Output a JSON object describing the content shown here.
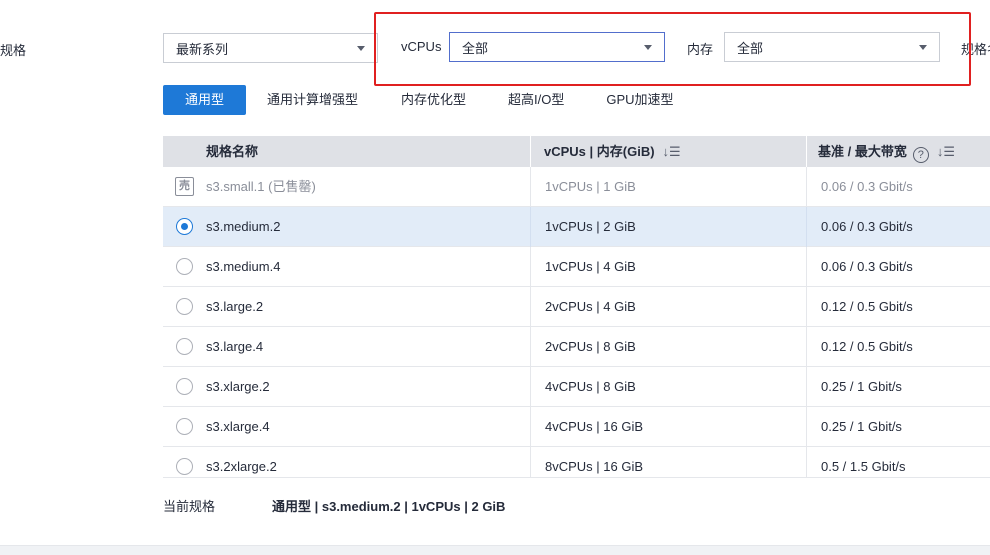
{
  "filters": {
    "section_label": "规格",
    "series": {
      "value": "最新系列"
    },
    "vcpus": {
      "label": "vCPUs",
      "value": "全部"
    },
    "memory": {
      "label": "内存",
      "value": "全部"
    },
    "spec_label_clipped": "规格名"
  },
  "tabs": [
    {
      "label": "通用型",
      "active": true
    },
    {
      "label": "通用计算增强型",
      "active": false
    },
    {
      "label": "内存优化型",
      "active": false
    },
    {
      "label": "超高I/O型",
      "active": false
    },
    {
      "label": "GPU加速型",
      "active": false
    }
  ],
  "table": {
    "headers": {
      "name": "规格名称",
      "cpu_mem": "vCPUs | 内存(GiB)",
      "bandwidth": "基准 / 最大带宽",
      "help": "?",
      "sort": "↓☰"
    },
    "soldout_icon_glyph": "売",
    "rows": [
      {
        "name": "s3.small.1 (已售罄)",
        "cpu_mem": "1vCPUs | 1 GiB",
        "bandwidth": "0.06 / 0.3 Gbit/s",
        "state": "soldout"
      },
      {
        "name": "s3.medium.2",
        "cpu_mem": "1vCPUs | 2 GiB",
        "bandwidth": "0.06 / 0.3 Gbit/s",
        "state": "selected"
      },
      {
        "name": "s3.medium.4",
        "cpu_mem": "1vCPUs | 4 GiB",
        "bandwidth": "0.06 / 0.3 Gbit/s",
        "state": "normal"
      },
      {
        "name": "s3.large.2",
        "cpu_mem": "2vCPUs | 4 GiB",
        "bandwidth": "0.12 / 0.5 Gbit/s",
        "state": "normal"
      },
      {
        "name": "s3.large.4",
        "cpu_mem": "2vCPUs | 8 GiB",
        "bandwidth": "0.12 / 0.5 Gbit/s",
        "state": "normal"
      },
      {
        "name": "s3.xlarge.2",
        "cpu_mem": "4vCPUs | 8 GiB",
        "bandwidth": "0.25 / 1 Gbit/s",
        "state": "normal"
      },
      {
        "name": "s3.xlarge.4",
        "cpu_mem": "4vCPUs | 16 GiB",
        "bandwidth": "0.25 / 1 Gbit/s",
        "state": "normal"
      },
      {
        "name": "s3.2xlarge.2",
        "cpu_mem": "8vCPUs | 16 GiB",
        "bandwidth": "0.5 / 1.5 Gbit/s",
        "state": "normal"
      }
    ]
  },
  "current": {
    "label": "当前规格",
    "value": "通用型 | s3.medium.2 | 1vCPUs | 2 GiB"
  },
  "colors": {
    "accent": "#1e79d7",
    "highlight_box": "#e02020",
    "selected_row": "#e2ecf8",
    "header_bg": "#dfe1e6"
  }
}
